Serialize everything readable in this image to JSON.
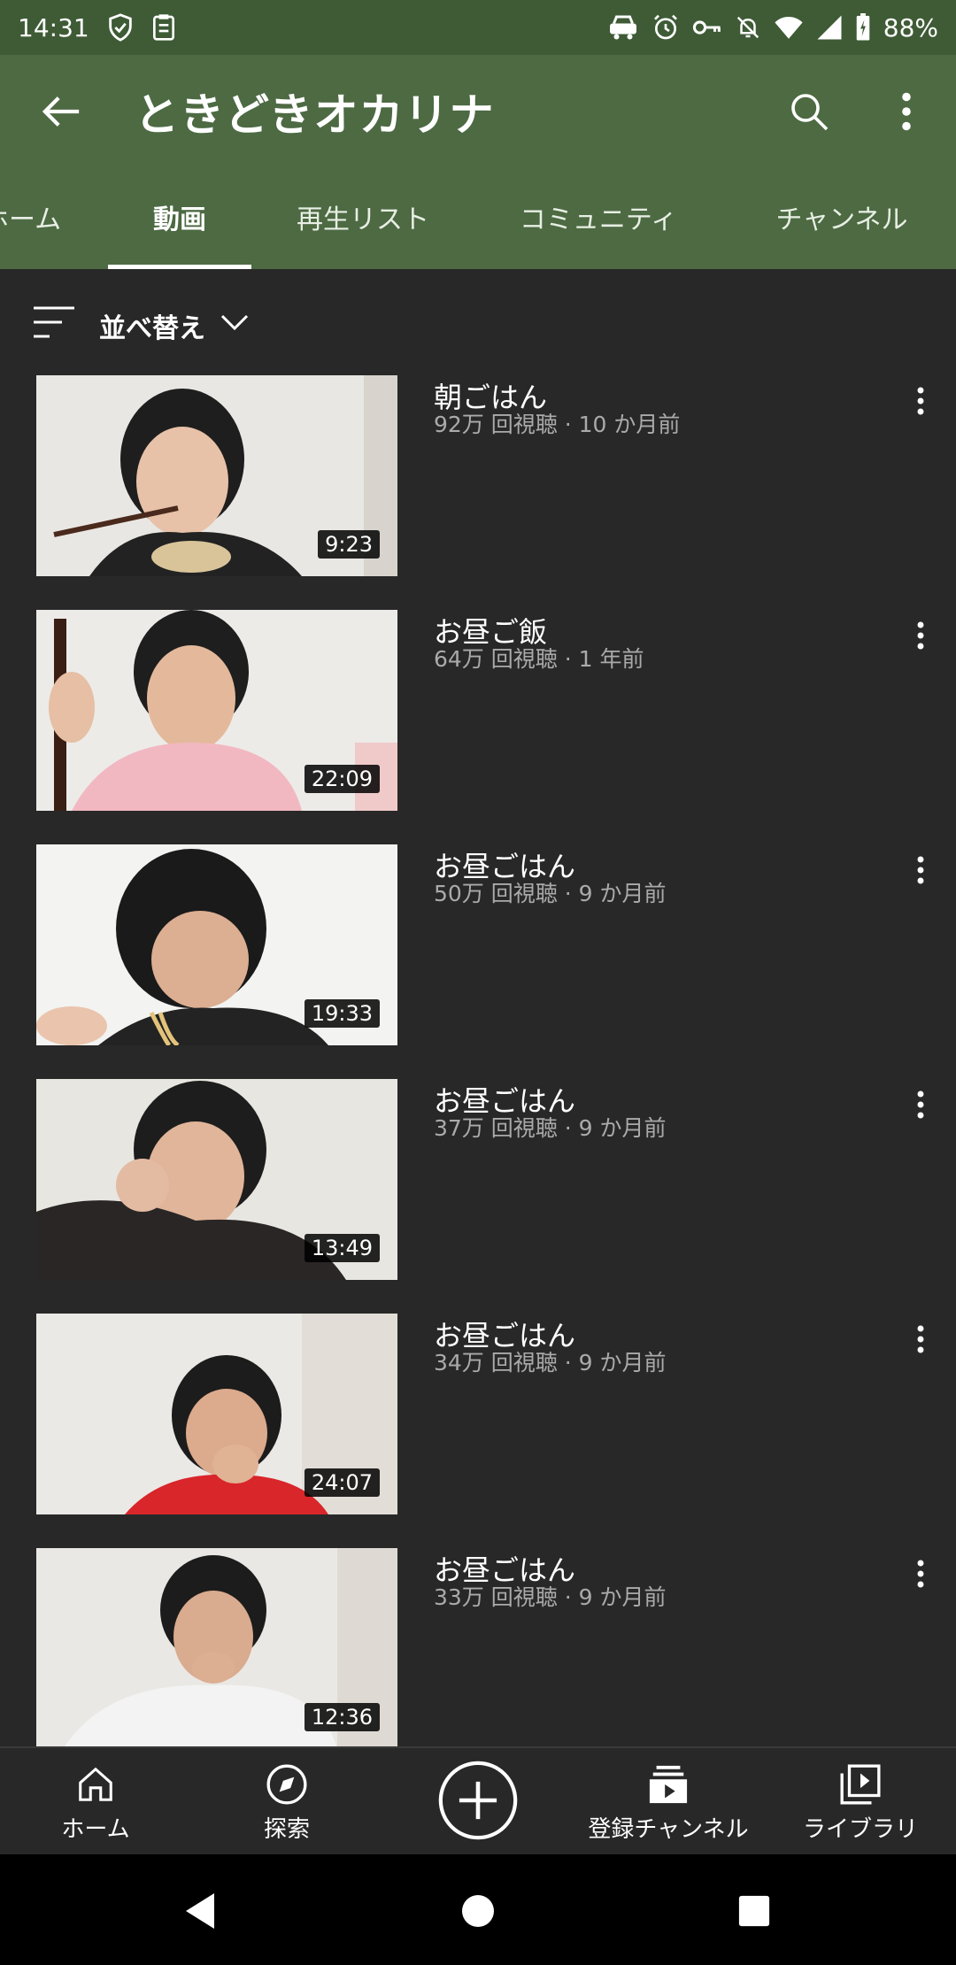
{
  "status_bar": {
    "time": "14:31",
    "battery": "88%"
  },
  "app_bar": {
    "channel_title": "ときどきオカリナ"
  },
  "tabs": [
    {
      "label": "ホーム"
    },
    {
      "label": "動画"
    },
    {
      "label": "再生リスト"
    },
    {
      "label": "コミュニティ"
    },
    {
      "label": "チャンネル"
    }
  ],
  "sort": {
    "label": "並べ替え"
  },
  "videos": [
    {
      "title": "朝ごはん",
      "meta": "92万 回視聴 · 10 か月前",
      "duration": "9:23"
    },
    {
      "title": "お昼ご飯",
      "meta": "64万 回視聴 · 1 年前",
      "duration": "22:09"
    },
    {
      "title": "お昼ごはん",
      "meta": "50万 回視聴 · 9 か月前",
      "duration": "19:33"
    },
    {
      "title": "お昼ごはん",
      "meta": "37万 回視聴 · 9 か月前",
      "duration": "13:49"
    },
    {
      "title": "お昼ごはん",
      "meta": "34万 回視聴 · 9 か月前",
      "duration": "24:07"
    },
    {
      "title": "お昼ごはん",
      "meta": "33万 回視聴 · 9 か月前",
      "duration": "12:36"
    }
  ],
  "bottom_nav": [
    {
      "label": "ホーム",
      "icon": "home-icon"
    },
    {
      "label": "探索",
      "icon": "compass-icon"
    },
    {
      "label": "",
      "icon": "add-circle-icon"
    },
    {
      "label": "登録チャンネル",
      "icon": "subscriptions-icon"
    },
    {
      "label": "ライブラリ",
      "icon": "library-icon"
    }
  ],
  "colors": {
    "header": "#4d6a43",
    "status_bar": "#3e5b36",
    "background": "#282828",
    "secondary_text": "#aaaaaa"
  }
}
